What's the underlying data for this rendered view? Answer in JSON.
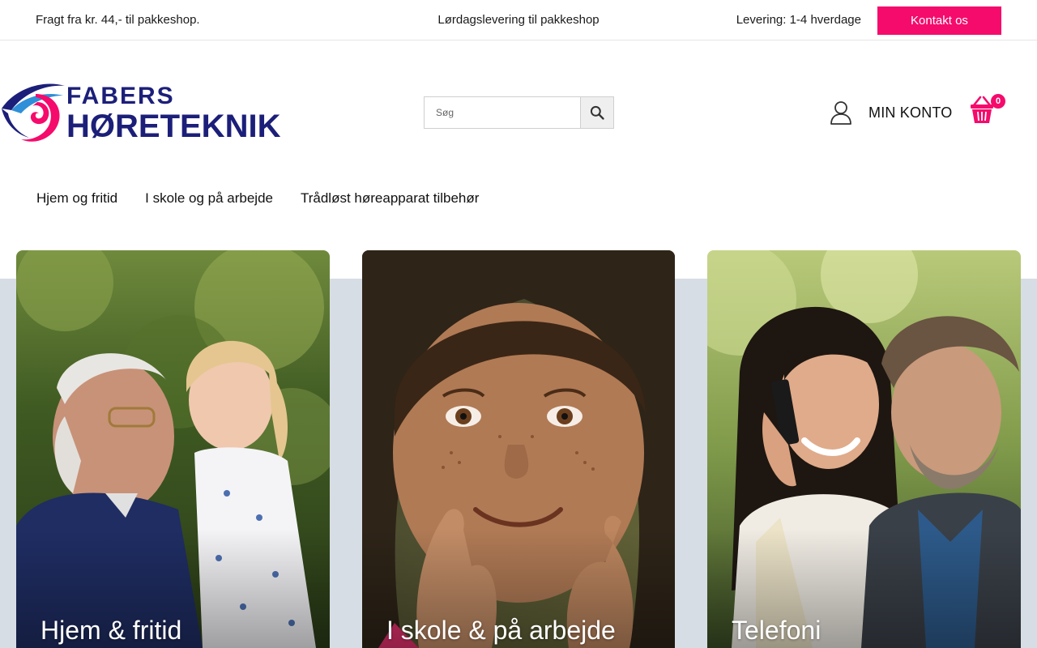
{
  "topbar": {
    "shipping_text": "Fragt fra kr. 44,- til pakkeshop.",
    "saturday_text": "Lørdagslevering til pakkeshop",
    "delivery_text": "Levering: 1-4 hverdage",
    "contact_label": "Kontakt os"
  },
  "logo": {
    "line1": "FABERS",
    "line2": "HØRETEKNIK"
  },
  "search": {
    "placeholder": "Søg",
    "icon": "search-icon"
  },
  "account": {
    "label": "MIN KONTO",
    "icon": "user-icon"
  },
  "cart": {
    "count": "0",
    "icon": "basket-icon"
  },
  "nav": {
    "items": [
      {
        "label": "Hjem og fritid"
      },
      {
        "label": "I skole og på arbejde"
      },
      {
        "label": "Trådløst høreapparat tilbehør"
      }
    ]
  },
  "cards": [
    {
      "title": "Hjem & fritid"
    },
    {
      "title": "I skole & på arbejde"
    },
    {
      "title": "Telefoni"
    }
  ],
  "colors": {
    "accent": "#f50b6c",
    "brand_navy": "#1c1f79",
    "band": "#d7dde4"
  }
}
